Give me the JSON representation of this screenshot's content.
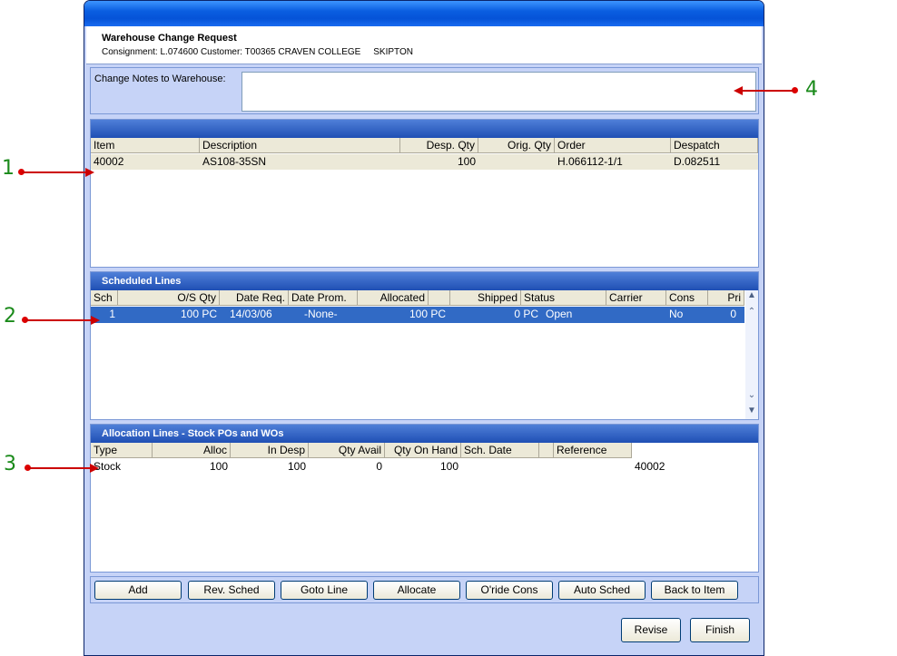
{
  "header": {
    "title": "Warehouse Change Request",
    "subtitle": "Consignment: L.074600 Customer: T00365 CRAVEN COLLEGE     SKIPTON"
  },
  "notes": {
    "label": "Change Notes to Warehouse:",
    "value": ""
  },
  "items": {
    "columns": [
      "Item",
      "Description",
      "Desp. Qty",
      "Orig. Qty",
      "Order",
      "Despatch"
    ],
    "rows": [
      {
        "item": "40002",
        "description": "AS108-35SN",
        "desp_qty": "100",
        "orig_qty": "",
        "order": "H.066112-1/1",
        "despatch": "D.082511"
      }
    ]
  },
  "scheduled": {
    "title": "Scheduled Lines",
    "columns": [
      "Sch",
      "O/S Qty",
      "Date Req.",
      "Date Prom.",
      "Allocated",
      "Shipped",
      "Status",
      "Carrier",
      "Cons",
      "Pri"
    ],
    "rows": [
      {
        "sch": "1",
        "os_qty": "100 PC",
        "date_req": "14/03/06",
        "date_prom": "-None-",
        "allocated": "100 PC",
        "shipped": "0 PC",
        "status": "Open",
        "carrier": "",
        "cons": "No",
        "pri": "0"
      }
    ]
  },
  "allocation": {
    "title": "Allocation Lines - Stock POs and WOs",
    "columns": [
      "Type",
      "Alloc",
      "In Desp",
      "Qty Avail",
      "Qty On Hand",
      "Sch. Date",
      "Reference"
    ],
    "rows": [
      {
        "type": "Stock",
        "alloc": "100",
        "in_desp": "100",
        "qty_avail": "0",
        "qty_on_hand": "100",
        "sch_date": "",
        "reference": "40002"
      }
    ]
  },
  "buttons": {
    "add": "Add",
    "rev_sched": "Rev. Sched",
    "goto_line": "Goto Line",
    "allocate": "Allocate",
    "oride_cons": "O'ride Cons",
    "auto_sched": "Auto Sched",
    "back_to_item": "Back to Item",
    "revise": "Revise",
    "finish": "Finish"
  },
  "annotations": [
    "1",
    "2",
    "3",
    "4"
  ],
  "colors": {
    "accent": "#316ac5",
    "annotation_number": "#1a8a1a",
    "annotation_arrow": "#cc0000"
  }
}
